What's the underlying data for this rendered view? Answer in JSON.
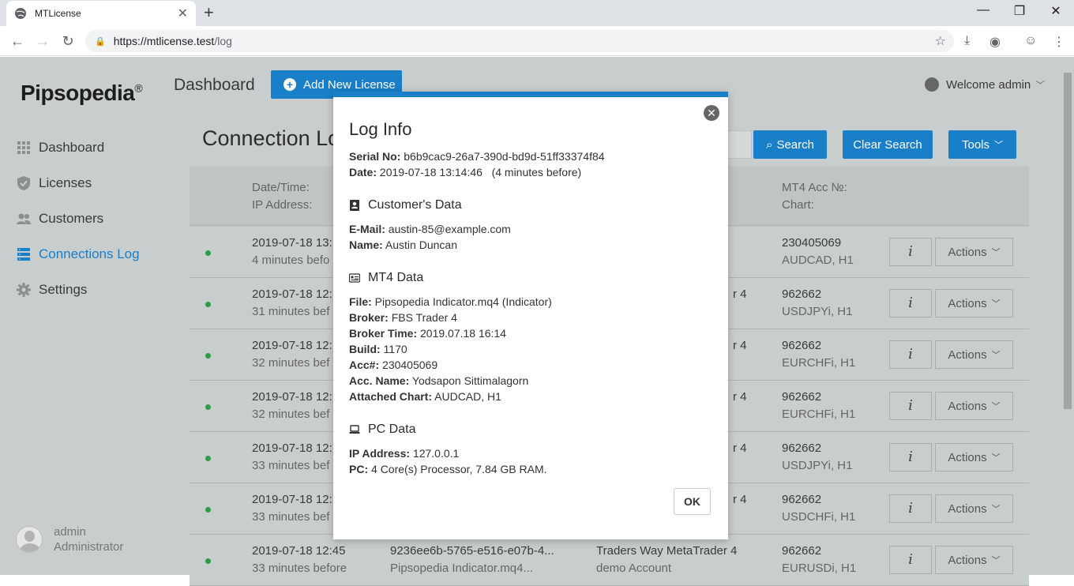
{
  "browser": {
    "tab_title": "MTLicense",
    "new_tab": "+",
    "url_host": "https://mtlicense.test",
    "url_path": "/log"
  },
  "app": {
    "brand": "Pipsopedia",
    "brand_mark": "®",
    "topbar_title": "Dashboard",
    "add_button": "Add New License",
    "welcome": "Welcome admin",
    "page_title": "Connection Log",
    "search_button": "Search",
    "clear_search_button": "Clear Search",
    "tools_button": "Tools"
  },
  "sidebar": {
    "items": [
      {
        "label": "Dashboard"
      },
      {
        "label": "Licenses"
      },
      {
        "label": "Customers"
      },
      {
        "label": "Connections Log"
      },
      {
        "label": "Settings"
      }
    ],
    "user_name": "admin",
    "user_role": "Administrator"
  },
  "table": {
    "headers": {
      "date_time": "Date/Time:",
      "ip_address": "IP Address:",
      "mt4_acc": "MT4 Acc №:",
      "chart": "Chart:"
    },
    "rows": [
      {
        "date": "2019-07-18 13:",
        "ago": "4 minutes befo",
        "serial": "",
        "file": "",
        "broker": "",
        "account": "",
        "acc": "230405069",
        "chart": "AUDCAD, H1"
      },
      {
        "date": "2019-07-18 12:",
        "ago": "31 minutes bef",
        "serial": "",
        "file": "",
        "broker": "r 4",
        "account": "",
        "acc": "962662",
        "chart": "USDJPYi, H1"
      },
      {
        "date": "2019-07-18 12:",
        "ago": "32 minutes bef",
        "serial": "",
        "file": "",
        "broker": "r 4",
        "account": "",
        "acc": "962662",
        "chart": "EURCHFi, H1"
      },
      {
        "date": "2019-07-18 12:",
        "ago": "32 minutes bef",
        "serial": "",
        "file": "",
        "broker": "r 4",
        "account": "",
        "acc": "962662",
        "chart": "EURCHFi, H1"
      },
      {
        "date": "2019-07-18 12:",
        "ago": "33 minutes bef",
        "serial": "",
        "file": "",
        "broker": "r 4",
        "account": "",
        "acc": "962662",
        "chart": "USDJPYi, H1"
      },
      {
        "date": "2019-07-18 12:",
        "ago": "33 minutes bef",
        "serial": "",
        "file": "",
        "broker": "r 4",
        "account": "",
        "acc": "962662",
        "chart": "USDCHFi, H1"
      },
      {
        "date": "2019-07-18 12:45",
        "ago": "33 minutes before",
        "serial": "9236ee6b-5765-e516-e07b-4...",
        "file": "Pipsopedia Indicator.mq4...",
        "broker": "Traders Way MetaTrader 4",
        "account": "demo Account",
        "acc": "962662",
        "chart": "EURUSDi, H1"
      }
    ],
    "info_label": "i",
    "actions_label": "Actions"
  },
  "modal": {
    "title": "Log Info",
    "serial_label": "Serial No:",
    "serial_value": "b6b9cac9-26a7-390d-bd9d-51ff33374f84",
    "date_label": "Date:",
    "date_value": "2019-07-18 13:14:46   (4 minutes before)",
    "customer_section": "Customer's Data",
    "email_label": "E-Mail:",
    "email_value": "austin-85@example.com",
    "name_label": "Name:",
    "name_value": "Austin Duncan",
    "mt4_section": "MT4 Data",
    "file_label": "File:",
    "file_value": "Pipsopedia Indicator.mq4 (Indicator)",
    "broker_label": "Broker:",
    "broker_value": "FBS Trader 4",
    "broker_time_label": "Broker Time:",
    "broker_time_value": "2019.07.18 16:14",
    "build_label": "Build:",
    "build_value": "1170",
    "acc_label": "Acc#:",
    "acc_value": "230405069",
    "acc_name_label": "Acc. Name:",
    "acc_name_value": "Yodsapon Sittimalagorn",
    "chart_label": "Attached Chart:",
    "chart_value": "AUDCAD, H1",
    "pc_section": "PC Data",
    "ip_label": "IP Address:",
    "ip_value": "127.0.0.1",
    "pc_label": "PC:",
    "pc_value": "4 Core(s) Processor, 7.84 GB RAM.",
    "ok_button": "OK"
  },
  "colors": {
    "accent": "#1a7fc9",
    "online_dot": "#2e9b47",
    "overlay_bg": "#c8cdcd"
  }
}
